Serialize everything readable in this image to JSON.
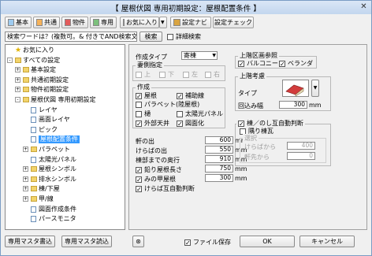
{
  "window": {
    "title": "【 屋根伏図 専用初期設定：屋根配置条件 】",
    "close": "✕"
  },
  "toolbar": {
    "basic": "基本",
    "common": "共通",
    "property": "物件",
    "dedicated": "専用",
    "favorites": "お気に入り",
    "settings_navi": "設定ナビ",
    "settings_check": "設定チェック"
  },
  "search": {
    "placeholder": "検索ワードは？(複数可。& 付きでAND検索文字)",
    "button": "検索",
    "detail_label": "詳細検索",
    "detail_checked": false
  },
  "tree": [
    {
      "label": "お気に入り",
      "level": 0,
      "icon": "star",
      "exp": ""
    },
    {
      "label": "すべての設定",
      "level": 0,
      "icon": "folder",
      "exp": "-"
    },
    {
      "label": "基本設定",
      "level": 1,
      "icon": "folder",
      "exp": "+"
    },
    {
      "label": "共通初期設定",
      "level": 1,
      "icon": "folder",
      "exp": "+"
    },
    {
      "label": "物件初期設定",
      "level": 1,
      "icon": "folder",
      "exp": "+"
    },
    {
      "label": "屋根伏図 専用初期設定",
      "level": 1,
      "icon": "folder",
      "exp": "-"
    },
    {
      "label": "レイヤ",
      "level": 2,
      "icon": "doc",
      "exp": ""
    },
    {
      "label": "画面レイヤ",
      "level": 2,
      "icon": "doc",
      "exp": ""
    },
    {
      "label": "ピック",
      "level": 2,
      "icon": "doc",
      "exp": ""
    },
    {
      "label": "屋根配置条件",
      "level": 2,
      "icon": "doc",
      "exp": "",
      "selected": true
    },
    {
      "label": "パラペット",
      "level": 2,
      "icon": "folder",
      "exp": "+"
    },
    {
      "label": "太陽光パネル",
      "level": 2,
      "icon": "doc",
      "exp": ""
    },
    {
      "label": "屋根シンボル",
      "level": 2,
      "icon": "folder",
      "exp": "+"
    },
    {
      "label": "排水シンボル",
      "level": 2,
      "icon": "folder",
      "exp": "+"
    },
    {
      "label": "棟/下屋",
      "level": 2,
      "icon": "folder",
      "exp": "+"
    },
    {
      "label": "甲/線",
      "level": 2,
      "icon": "folder",
      "exp": "+"
    },
    {
      "label": "図面作成条件",
      "level": 2,
      "icon": "doc",
      "exp": ""
    },
    {
      "label": "パースモニタ",
      "level": 2,
      "icon": "doc",
      "exp": ""
    }
  ],
  "form": {
    "create_type_label": "作成タイプ",
    "create_type_value": "寄棟",
    "direction": {
      "label": "妻側指定",
      "items": [
        "上",
        "下",
        "左",
        "右"
      ]
    },
    "create": {
      "label": "作成",
      "items": [
        {
          "label": "屋根",
          "checked": true
        },
        {
          "label": "補助線",
          "checked": true
        },
        {
          "label": "パラペット(陸屋根)",
          "checked": false
        },
        {
          "label": "樋",
          "checked": false
        },
        {
          "label": "太陽光パネル",
          "checked": false
        },
        {
          "label": "外部天井",
          "checked": true
        },
        {
          "label": "図面化",
          "checked": true
        }
      ]
    },
    "eave": {
      "label": "軒の出",
      "value": "600",
      "unit": "mm"
    },
    "gable": {
      "label": "けらばの出",
      "value": "550",
      "unit": "mm"
    },
    "height": {
      "label": "棟部までの奥行",
      "value": "910",
      "unit": "mm"
    },
    "wrap": {
      "label": "鉛り屋根長さ",
      "value": "750",
      "unit": "mm",
      "checked": true
    },
    "tail": {
      "label": "みの甲屋根",
      "value": "300",
      "unit": "mm",
      "checked": true
    },
    "gable_judge": {
      "label": "けらば互自動判断",
      "checked": true
    }
  },
  "right": {
    "upper_ref": {
      "label": "上階区画参照",
      "balcony": "バルコニー",
      "veranda": "ベランダ",
      "balcony_checked": true,
      "veranda_checked": true
    },
    "upper_consider": {
      "label": "上階考慮",
      "type_label": "タイプ",
      "rotate_label": "回込み幅",
      "rotate_value": "300",
      "unit": "mm"
    },
    "ridge": {
      "label": "棟／のし互自動判断",
      "checked": true,
      "sub_label": "隅り棟瓦",
      "sub_checked": false,
      "cond_label": "選択",
      "from_label": "けらばから",
      "from_value": "400",
      "eave_label": "軒先から",
      "eave_value": "0"
    }
  },
  "footer": {
    "write_master": "専用マスタ書込",
    "read_master": "専用マスタ読込",
    "file_save": "ファイル保存",
    "file_save_checked": true,
    "ok": "OK",
    "cancel": "キャンセル"
  }
}
